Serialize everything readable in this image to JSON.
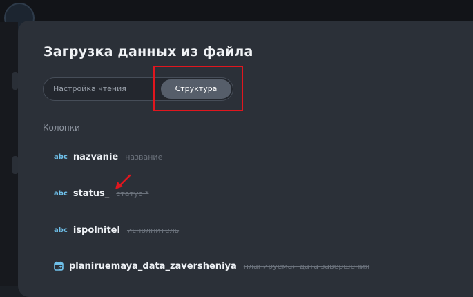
{
  "modal": {
    "title": "Загрузка данных из файла",
    "tabs": [
      {
        "label": "Настройка чтения",
        "active": false
      },
      {
        "label": "Структура",
        "active": true
      }
    ],
    "section_label": "Колонки",
    "columns": [
      {
        "type_icon": "abc",
        "name": "nazvanie",
        "alias": "название"
      },
      {
        "type_icon": "abc",
        "name": "status_",
        "alias": "статус *"
      },
      {
        "type_icon": "abc",
        "name": "ispolnitel",
        "alias": "исполнитель"
      },
      {
        "type_icon": "calendar-icon",
        "name": "planiruemaya_data_zaversheniya",
        "alias": "планируемая дата завершения"
      }
    ]
  },
  "colors": {
    "annotation_red": "#e0161e",
    "type_icon_blue": "#6fc0ea",
    "modal_bg": "#2b3038"
  }
}
